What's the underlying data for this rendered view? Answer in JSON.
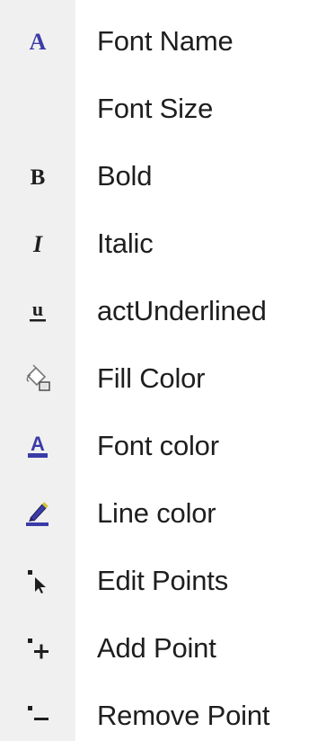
{
  "menu": {
    "items": [
      {
        "label": "Font Name",
        "icon": "font-name-icon"
      },
      {
        "label": "Font Size",
        "icon": "none"
      },
      {
        "label": "Bold",
        "icon": "bold-icon"
      },
      {
        "label": "Italic",
        "icon": "italic-icon"
      },
      {
        "label": "actUnderlined",
        "icon": "underline-icon"
      },
      {
        "label": "Fill Color",
        "icon": "paint-bucket-icon"
      },
      {
        "label": "Font color",
        "icon": "font-color-icon"
      },
      {
        "label": "Line color",
        "icon": "line-color-pen-icon"
      },
      {
        "label": "Edit Points",
        "icon": "edit-points-icon"
      },
      {
        "label": "Add Point",
        "icon": "add-point-icon"
      },
      {
        "label": "Remove Point",
        "icon": "remove-point-icon"
      }
    ]
  },
  "colors": {
    "gutter": "#f0f0f0",
    "accent": "#3b3ba8",
    "text": "#1e1e1e"
  }
}
